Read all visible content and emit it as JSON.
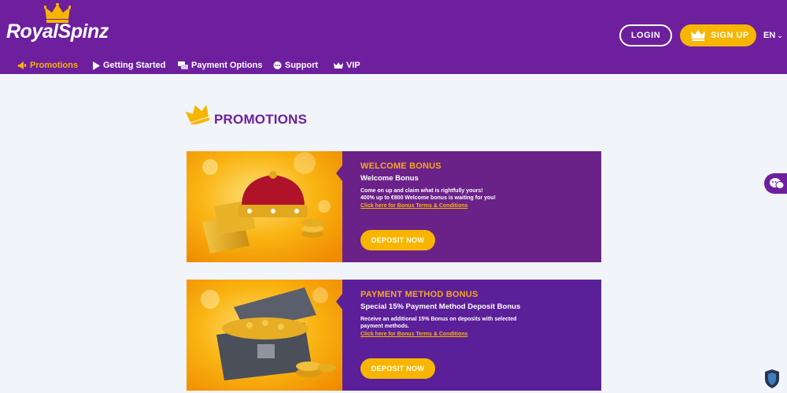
{
  "brand": {
    "logo_text": "RoyalSpinz"
  },
  "header": {
    "login_label": "LOGIN",
    "signup_label": "SIGN UP",
    "language": "EN"
  },
  "nav": {
    "items": [
      {
        "label": "Promotions",
        "icon": "megaphone-icon",
        "active": true
      },
      {
        "label": "Getting Started",
        "icon": "play-icon",
        "active": false
      },
      {
        "label": "Payment Options",
        "icon": "payment-cards-icon",
        "active": false
      },
      {
        "label": "Support",
        "icon": "chat-bubble-icon",
        "active": false
      },
      {
        "label": "VIP",
        "icon": "crown-icon",
        "active": false
      }
    ]
  },
  "page": {
    "title": "PROMOTIONS"
  },
  "promotions": [
    {
      "title": "WELCOME BONUS",
      "subtitle": "Welcome Bonus",
      "description_lines": [
        "Come on up and claim what is rightfully yours!",
        "400% up to €800 Welcome bonus is waiting for you!"
      ],
      "terms_link": "Click here for Bonus Terms & Conditions",
      "button_label": "DEPOSIT NOW",
      "image": "crown-gold-bars-image"
    },
    {
      "title": "PAYMENT METHOD BONUS",
      "subtitle": "Special 15% Payment Method Deposit Bonus",
      "description_lines": [
        "Receive an additional 15% Bonus on deposits with selected",
        "payment methods."
      ],
      "terms_link": "Click here for Bonus Terms & Conditions",
      "button_label": "DEPOSIT NOW",
      "image": "treasure-chest-image"
    }
  ],
  "colors": {
    "header_bg": "#6d1f9e",
    "accent": "#f7b500",
    "page_bg": "#f1f4f8"
  }
}
